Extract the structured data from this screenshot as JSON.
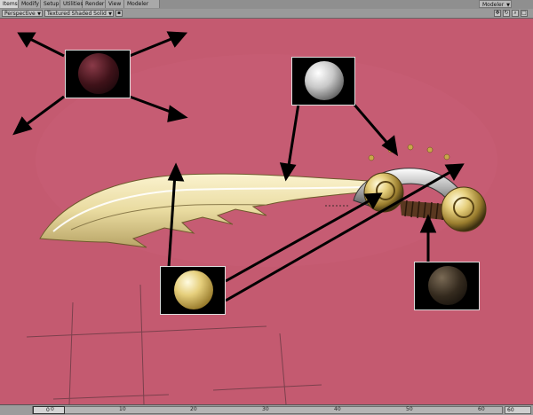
{
  "tabs": [
    {
      "label": "Items",
      "active": true
    },
    {
      "label": "Modify",
      "active": false
    },
    {
      "label": "Setup",
      "active": false
    },
    {
      "label": "Utilities",
      "active": false
    },
    {
      "label": "Render",
      "active": false
    },
    {
      "label": "View",
      "active": false
    },
    {
      "label": "Modeler Tools",
      "active": false
    }
  ],
  "modeler_button": "Modeler",
  "viewbar": {
    "view_mode": "Perspective",
    "shading_mode": "Textured Shaded Solid"
  },
  "timeline": {
    "ticks": [
      "0",
      "10",
      "20",
      "30",
      "40",
      "50",
      "60"
    ],
    "end_frame": "60",
    "current_frame": "0"
  },
  "viewport": {
    "background_color": "#c45a70",
    "material_swatches": [
      {
        "name": "dark-red",
        "color": "#4a1520"
      },
      {
        "name": "chrome",
        "color": "#cfcfcf"
      },
      {
        "name": "gold",
        "color": "#c8a648"
      },
      {
        "name": "dark-brown",
        "color": "#3a2e22"
      }
    ]
  }
}
